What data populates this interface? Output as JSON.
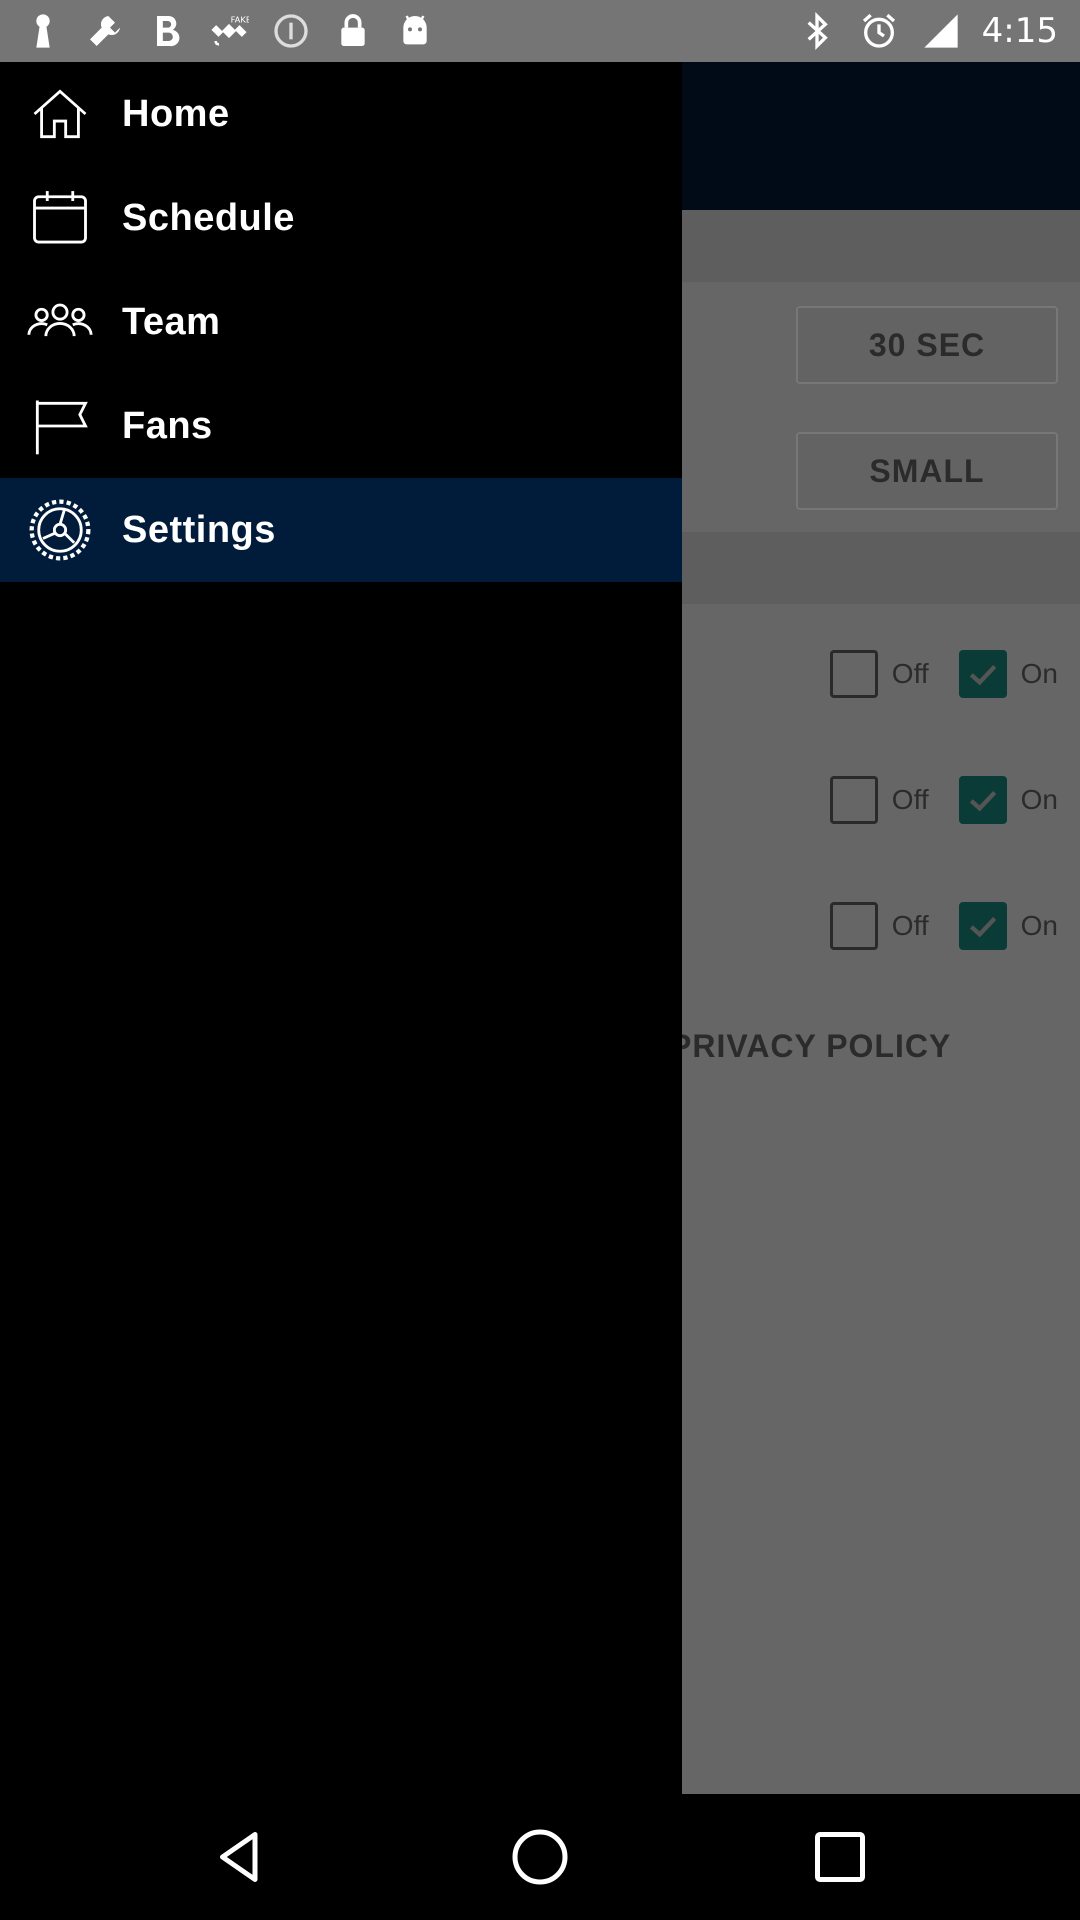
{
  "status_bar": {
    "time": "4:15",
    "left_icons": [
      "keyhole-icon",
      "wrench-icon",
      "bold-b-icon",
      "fake-gps-satellite-icon",
      "info-circle-icon",
      "lock-icon",
      "android-icon"
    ],
    "right_icons": [
      "bluetooth-icon",
      "alarm-icon",
      "signal-icon"
    ]
  },
  "drawer": {
    "items": [
      {
        "label": "Home",
        "icon": "home-icon"
      },
      {
        "label": "Schedule",
        "icon": "calendar-icon"
      },
      {
        "label": "Team",
        "icon": "team-icon"
      },
      {
        "label": "Fans",
        "icon": "flag-icon"
      },
      {
        "label": "Settings",
        "icon": "settings-icon",
        "active": true
      }
    ],
    "active_color": "#011c3a"
  },
  "background": {
    "interval_button": "30 SEC",
    "size_button": "SMALL",
    "toggles": [
      {
        "off_label": "Off",
        "on_label": "On",
        "on_checked": true
      },
      {
        "off_label": "Off",
        "on_label": "On",
        "on_checked": true
      },
      {
        "off_label": "Off",
        "on_label": "On",
        "on_checked": true
      }
    ],
    "privacy_link": "PRIVACY POLICY",
    "accent_color": "#0b3b36"
  },
  "nav_bar": {
    "back": "back-triangle-icon",
    "home": "home-circle-icon",
    "recents": "recents-square-icon"
  }
}
